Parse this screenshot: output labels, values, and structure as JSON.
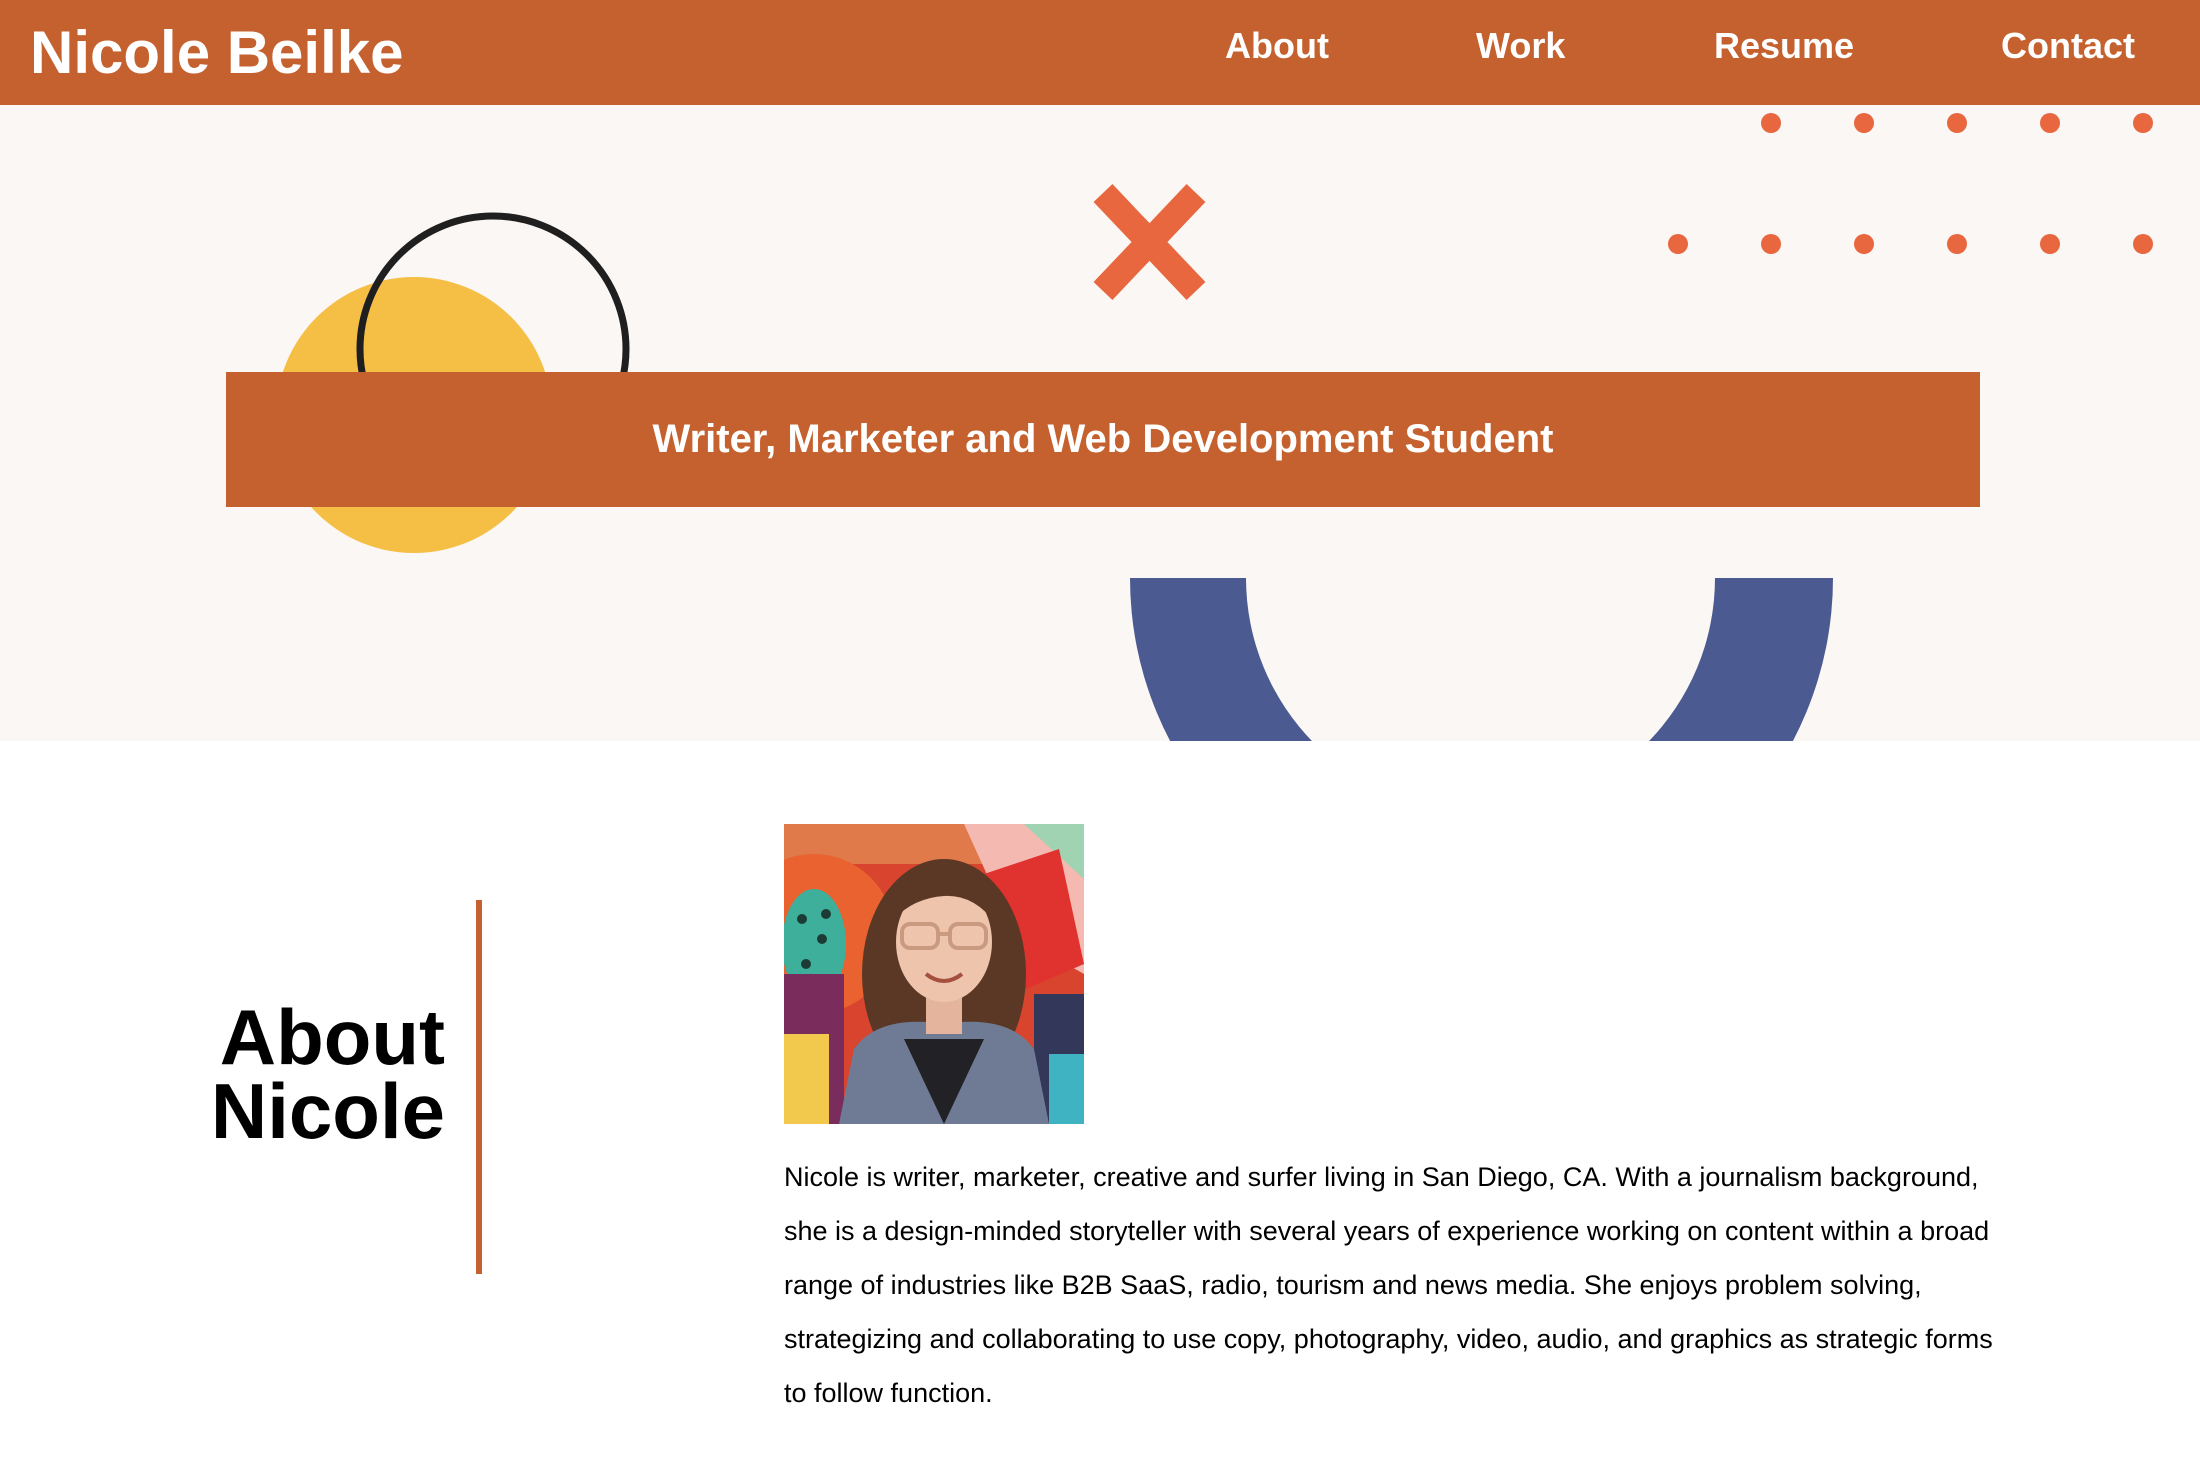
{
  "header": {
    "site_title": "Nicole Beilke",
    "nav": [
      {
        "label": "About"
      },
      {
        "label": "Work"
      },
      {
        "label": "Resume"
      },
      {
        "label": "Contact"
      }
    ]
  },
  "hero": {
    "tagline": "Writer, Marketer and Web Development Student",
    "decorations": [
      "yellow-circle",
      "black-ring-outline",
      "orange-x",
      "orange-dot-grid",
      "blue-arc"
    ]
  },
  "about": {
    "heading_line1": "About",
    "heading_line2": "Nicole",
    "photo": "portrait-photo",
    "body": "Nicole is writer, marketer, creative and surfer living in San Diego, CA. With a journalism background, she is a design-minded storyteller with several years of experience working on content within a broad range of industries like B2B SaaS, radio, tourism and news media. She enjoys problem solving, strategizing and collaborating to use copy, photography, video, audio, and graphics as strategic forms to follow function."
  },
  "colors": {
    "brand_orange": "#c5612e",
    "accent_orange": "#e8673f",
    "yellow": "#f5be45",
    "blue": "#4b5a90",
    "hero_background": "#fbf7f4"
  }
}
